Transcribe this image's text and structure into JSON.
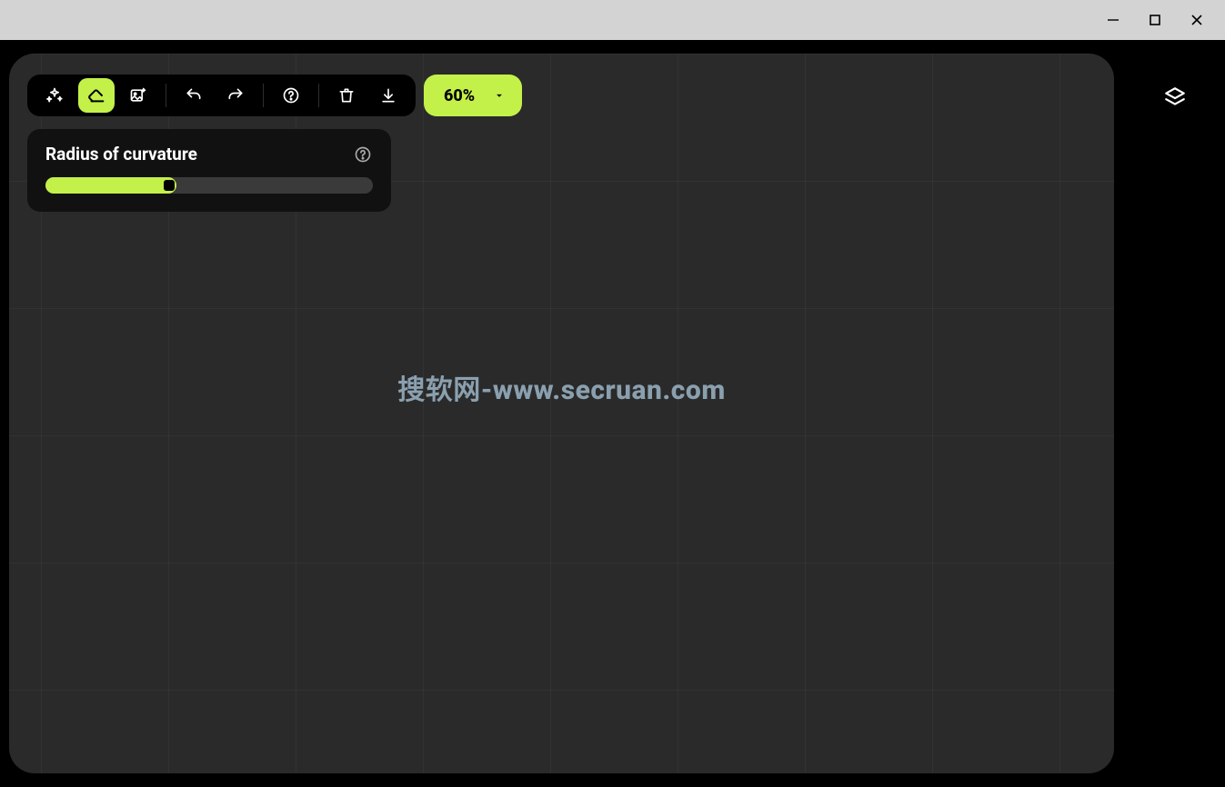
{
  "window": {
    "minimize": "–",
    "maximize": "☐",
    "close": "✕"
  },
  "toolbar": {
    "zoom_value": "60%"
  },
  "panel": {
    "title": "Radius of curvature",
    "slider_percent": 40
  },
  "canvas": {
    "watermark": "搜软网-www.secruan.com"
  }
}
